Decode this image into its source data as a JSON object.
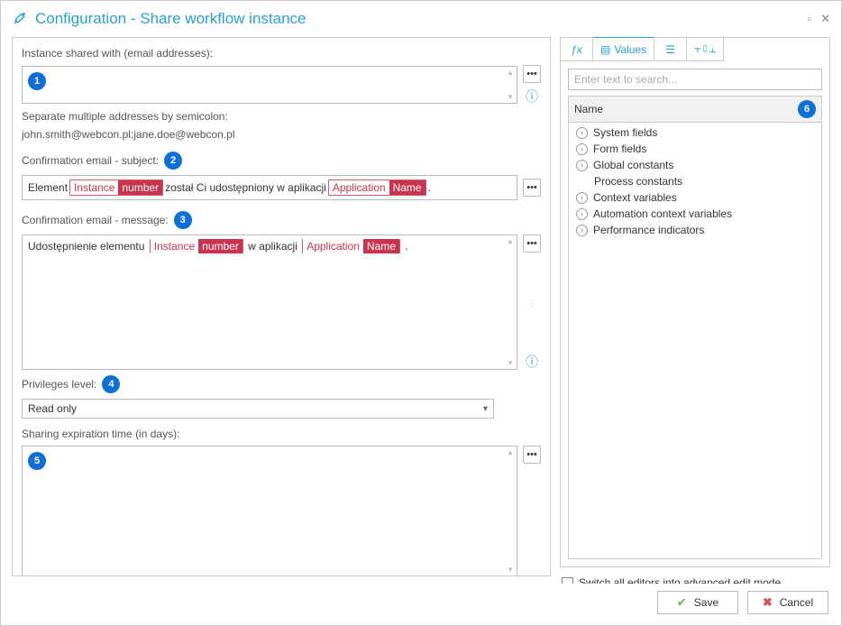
{
  "window": {
    "title": "Configuration - Share workflow instance"
  },
  "left": {
    "shared_with_label": "Instance shared with (email addresses):",
    "shared_with_value": "",
    "hint_line1": "Separate multiple addresses by semicolon:",
    "hint_line2": "john.smith@webcon.pl;jane.doe@webcon.pl",
    "subject_label": "Confirmation email - subject:",
    "subject_text_1": "Element ",
    "subject_text_2": " został Ci udostępniony w aplikacji ",
    "subject_text_3": ".",
    "message_label": "Confirmation email - message:",
    "message_text_1": "Udostępnienie elementu ",
    "message_text_2": " w aplikacji ",
    "message_text_3": ".",
    "token_instance_l": "Instance",
    "token_instance_r": "number",
    "token_app_l": "Application",
    "token_app_r": "Name",
    "privileges_label": "Privileges level:",
    "privileges_value": "Read only",
    "expiration_label": "Sharing expiration time (in days):",
    "expiration_value": ""
  },
  "right": {
    "tab_values": "Values",
    "search_placeholder": "Enter text to search...",
    "tree_header": "Name",
    "items": {
      "0": "System fields",
      "1": "Form fields",
      "2": "Global constants",
      "3": "Process constants",
      "4": "Context variables",
      "5": "Automation context variables",
      "6": "Performance indicators"
    },
    "advanced_mode": "Switch all editors into advanced edit mode"
  },
  "footer": {
    "save": "Save",
    "cancel": "Cancel"
  },
  "badges": {
    "1": "1",
    "2": "2",
    "3": "3",
    "4": "4",
    "5": "5",
    "6": "6"
  }
}
